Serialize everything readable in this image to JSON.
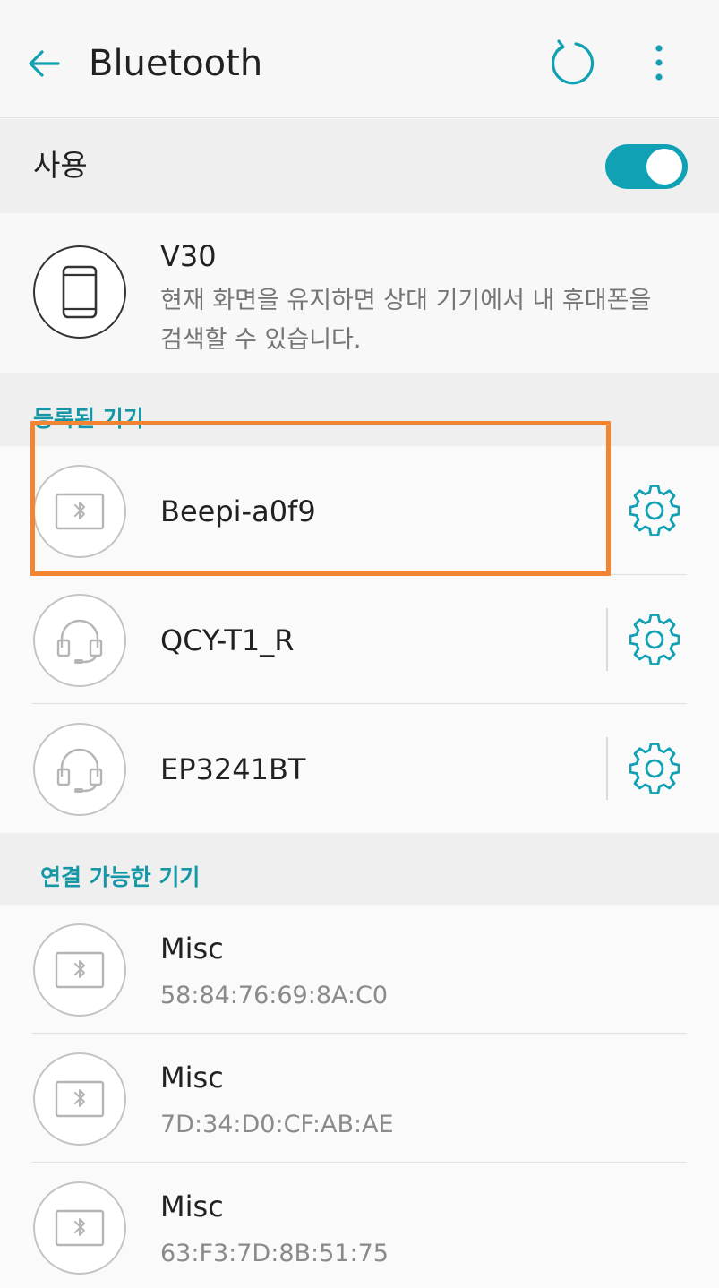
{
  "appbar": {
    "title": "Bluetooth",
    "back_icon": "arrow-left-icon",
    "refresh_icon": "refresh-icon",
    "more_icon": "more-vert-icon"
  },
  "use_toggle": {
    "label": "사용",
    "on": true
  },
  "my_device": {
    "name": "V30",
    "description": "현재 화면을 유지하면 상대 기기에서 내 휴대폰을 검색할 수 있습니다."
  },
  "registered": {
    "header": "등록된 기기",
    "items": [
      {
        "name": "Beepi-a0f9",
        "icon": "bluetooth-icon",
        "highlighted": true
      },
      {
        "name": "QCY-T1_R",
        "icon": "headset-icon"
      },
      {
        "name": "EP3241BT",
        "icon": "headset-icon"
      }
    ]
  },
  "available": {
    "header": "연결 가능한 기기",
    "items": [
      {
        "name": "Misc",
        "address": "58:84:76:69:8A:C0",
        "icon": "bluetooth-icon"
      },
      {
        "name": "Misc",
        "address": "7D:34:D0:CF:AB:AE",
        "icon": "bluetooth-icon"
      },
      {
        "name": "Misc",
        "address": "63:F3:7D:8B:51:75",
        "icon": "bluetooth-icon"
      }
    ]
  },
  "colors": {
    "accent": "#11a1b4",
    "section_text": "#1597a6",
    "highlight": "#f28432"
  }
}
